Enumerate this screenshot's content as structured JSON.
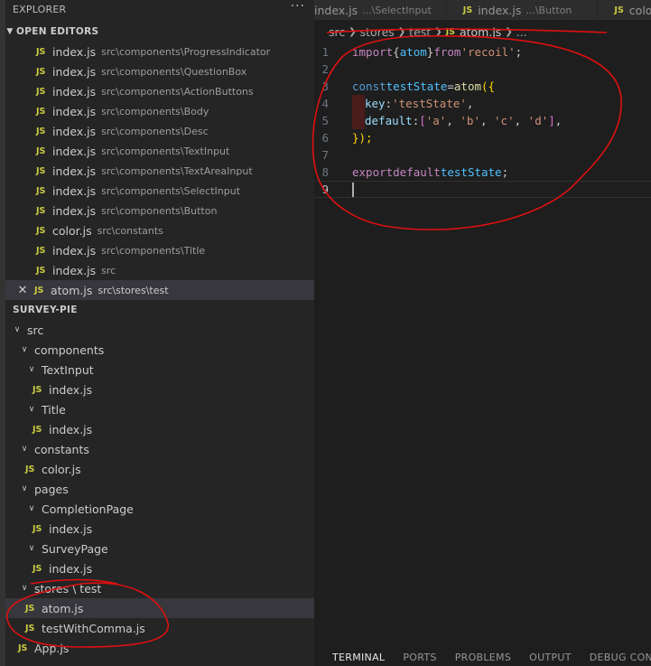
{
  "sidebar": {
    "title": "EXPLORER",
    "more": "···",
    "open_editors_label": "OPEN EDITORS",
    "open_editors": [
      {
        "name": "index.js",
        "path": "src\\components\\ProgressIndicator"
      },
      {
        "name": "index.js",
        "path": "src\\components\\QuestionBox"
      },
      {
        "name": "index.js",
        "path": "src\\components\\ActionButtons"
      },
      {
        "name": "index.js",
        "path": "src\\components\\Body"
      },
      {
        "name": "index.js",
        "path": "src\\components\\Desc"
      },
      {
        "name": "index.js",
        "path": "src\\components\\TextInput"
      },
      {
        "name": "index.js",
        "path": "src\\components\\TextAreaInput"
      },
      {
        "name": "index.js",
        "path": "src\\components\\SelectInput"
      },
      {
        "name": "index.js",
        "path": "src\\components\\Button"
      },
      {
        "name": "color.js",
        "path": "src\\constants"
      },
      {
        "name": "index.js",
        "path": "src\\components\\Title"
      },
      {
        "name": "index.js",
        "path": "src"
      },
      {
        "name": "atom.js",
        "path": "src\\stores\\test"
      }
    ],
    "project_label": "SURVEY-PIE",
    "tree": {
      "src": "src",
      "components": "components",
      "textinput": "TextInput",
      "textinput_index": "index.js",
      "title": "Title",
      "title_index": "index.js",
      "constants": "constants",
      "color": "color.js",
      "pages": "pages",
      "completion": "CompletionPage",
      "completion_index": "index.js",
      "survey": "SurveyPage",
      "survey_index": "index.js",
      "stores": "stores \\ test",
      "atom": "atom.js",
      "comma": "testWithComma.js",
      "app": "App.js"
    },
    "js_badge": "JS"
  },
  "tabs": [
    {
      "name": "index.js",
      "path": "...\\SelectInput",
      "js": false
    },
    {
      "name": "index.js",
      "path": "...\\Button",
      "js": true
    },
    {
      "name": "color.js",
      "path": "",
      "js": true
    }
  ],
  "breadcrumb": {
    "a": "src",
    "b": "stores",
    "c": "test",
    "file": "atom.js",
    "tail": "..."
  },
  "code": {
    "l1": {
      "import": "import",
      "open": "{",
      "atom": "atom",
      "close": "}",
      "from": "from",
      "mod": "'recoil'",
      "semi": ";"
    },
    "l3": {
      "const": "const",
      "name": "testState",
      "eq": "=",
      "fn": "atom",
      "open": "({"
    },
    "l4": {
      "key": "key",
      "colon": ":",
      "val": "'testState'",
      "comma": ","
    },
    "l5": {
      "key": "default",
      "colon": ":",
      "open": "[",
      "a": "'a'",
      "b": "'b'",
      "c": "'c'",
      "d": "'d'",
      "close": "]",
      "comma": ","
    },
    "l6": {
      "close": "});"
    },
    "l8": {
      "export": "export",
      "default": "default",
      "name": "testState",
      "semi": ";"
    },
    "line_numbers": [
      "1",
      "2",
      "3",
      "4",
      "5",
      "6",
      "7",
      "8",
      "9"
    ]
  },
  "panel": {
    "terminal": "TERMINAL",
    "ports": "PORTS",
    "problems": "PROBLEMS",
    "output": "OUTPUT",
    "debug": "DEBUG CONSOLE"
  },
  "colors": {
    "js_icon": "#cbcb41",
    "annotation": "#e01010",
    "selection": "#37373d"
  }
}
